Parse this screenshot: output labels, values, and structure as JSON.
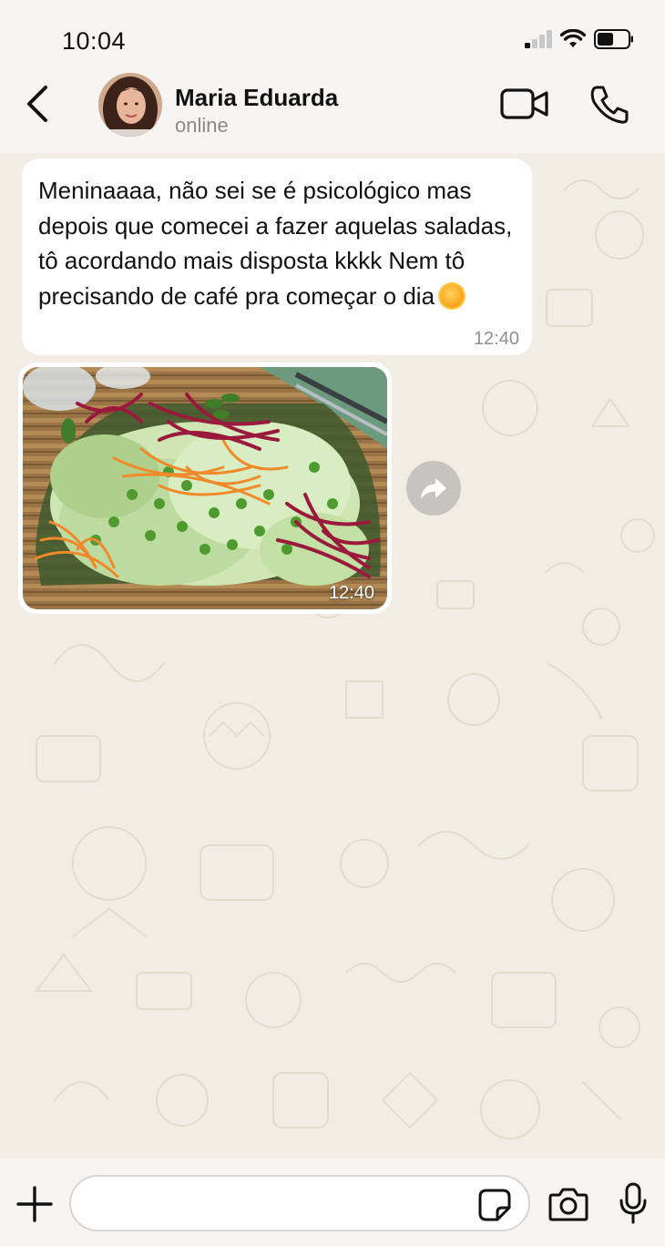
{
  "status_bar": {
    "time": "10:04",
    "signal_bars_active": 1,
    "battery_level": 0.5
  },
  "header": {
    "contact_name": "Maria Eduarda",
    "contact_status": "online",
    "icons": [
      "back-chevron-icon",
      "video-camera-icon",
      "phone-icon"
    ]
  },
  "messages": [
    {
      "type": "text",
      "direction": "incoming",
      "text": "Meninaaaa, não sei se é psicológico mas depois que comecei a fazer aquelas saladas, tô acordando mais disposta kkkk Nem tô precisando de café pra começar o dia",
      "emoji": "sun",
      "time": "12:40"
    },
    {
      "type": "image",
      "direction": "incoming",
      "subject": "salad",
      "time": "12:40"
    }
  ],
  "input_bar": {
    "placeholder": "",
    "icons": [
      "plus-icon",
      "sticker-icon",
      "camera-icon",
      "microphone-icon"
    ]
  },
  "colors": {
    "wallpaper": "#f2ede4",
    "bubble": "#ffffff",
    "bar": "#f6f5f3",
    "text": "#111111",
    "muted": "#8f8f8f"
  }
}
